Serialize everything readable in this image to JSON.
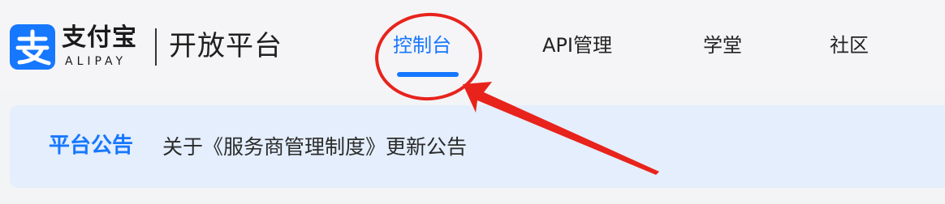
{
  "brand": {
    "name_cn": "支付宝",
    "name_en": "ALIPAY",
    "platform": "开放平台",
    "logo_glyph": "支",
    "color": "#1677ff"
  },
  "nav": {
    "items": [
      {
        "label": "控制台",
        "active": true
      },
      {
        "label": "API管理",
        "active": false
      },
      {
        "label": "学堂",
        "active": false
      },
      {
        "label": "社区",
        "active": false
      }
    ]
  },
  "notice": {
    "title": "平台公告",
    "text": "关于《服务商管理制度》更新公告"
  },
  "annotation": {
    "color": "#e8231c",
    "target": "控制台",
    "shapes": [
      "circle",
      "arrow"
    ]
  }
}
